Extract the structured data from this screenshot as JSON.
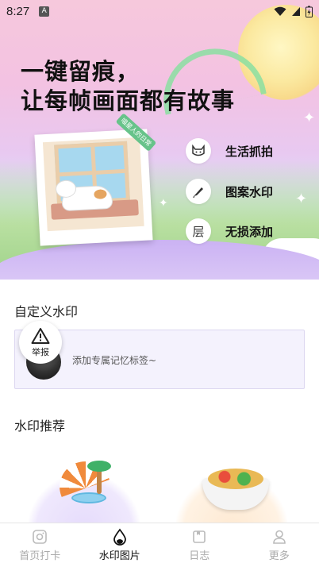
{
  "status_bar": {
    "time": "8:27",
    "indicator": "A"
  },
  "hero": {
    "title_line1": "一键留痕，",
    "title_line2": "让每帧画面都有故事",
    "photo_tag": "喵星人的日常",
    "features": [
      {
        "icon": "cat-face-icon",
        "label": "生活抓拍"
      },
      {
        "icon": "brush-icon",
        "label": "图案水印"
      },
      {
        "icon_text": "层",
        "label": "无损添加"
      }
    ]
  },
  "custom_watermark": {
    "title": "自定义水印",
    "hint": "添加专属记忆标签~"
  },
  "report": {
    "label": "举报"
  },
  "recommend": {
    "title": "水印推荐"
  },
  "nav": {
    "items": [
      {
        "label": "首页打卡",
        "icon": "camera-icon",
        "active": false
      },
      {
        "label": "水印图片",
        "icon": "water-drop-icon",
        "active": true
      },
      {
        "label": "日志",
        "icon": "calendar-icon",
        "active": false
      },
      {
        "label": "更多",
        "icon": "person-icon",
        "active": false
      }
    ]
  },
  "colors": {
    "accent_purple": "#cbb2f3",
    "active_text": "#111111",
    "inactive_text": "#aaaaaa"
  }
}
